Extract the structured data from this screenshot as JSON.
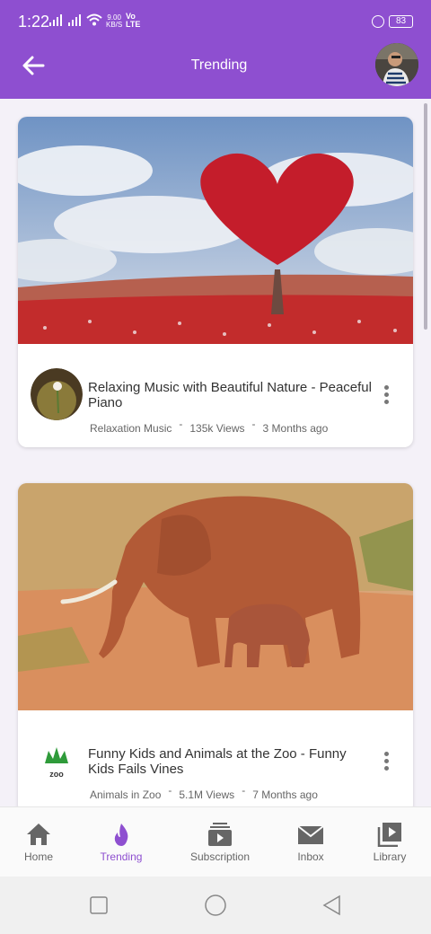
{
  "status_bar": {
    "time": "1:22",
    "net_speed_value": "9.00",
    "net_speed_unit": "KB/S",
    "volte_top": "Vo",
    "volte_bottom": "LTE",
    "battery": "83"
  },
  "app_bar": {
    "title": "Trending",
    "back_icon": "arrow-left-icon",
    "avatar_icon": "user-avatar"
  },
  "videos": [
    {
      "title": "Relaxing Music with Beautiful Nature - Peaceful Piano",
      "channel": "Relaxation Music",
      "views": "135k Views",
      "age": "3 Months ago",
      "separator": "-",
      "thumbnail_icon": "heart-tree-thumbnail",
      "channel_icon": "flower-avatar"
    },
    {
      "title": "Funny Kids and Animals at the Zoo - Funny Kids Fails Vines",
      "channel": "Animals in Zoo",
      "views": "5.1M Views",
      "age": "7 Months ago",
      "separator": "-",
      "thumbnail_icon": "elephants-thumbnail",
      "channel_icon": "zoo-logo",
      "channel_logo_text": "zoo"
    }
  ],
  "bottom_nav": [
    {
      "label": "Home",
      "icon": "home-icon",
      "active": false
    },
    {
      "label": "Trending",
      "icon": "flame-icon",
      "active": true
    },
    {
      "label": "Subscription",
      "icon": "subscription-icon",
      "active": false
    },
    {
      "label": "Inbox",
      "icon": "mail-icon",
      "active": false
    },
    {
      "label": "Library",
      "icon": "library-icon",
      "active": false
    }
  ],
  "colors": {
    "primary": "#8e4fd0",
    "background": "#f4f1f8",
    "card": "#ffffff"
  }
}
